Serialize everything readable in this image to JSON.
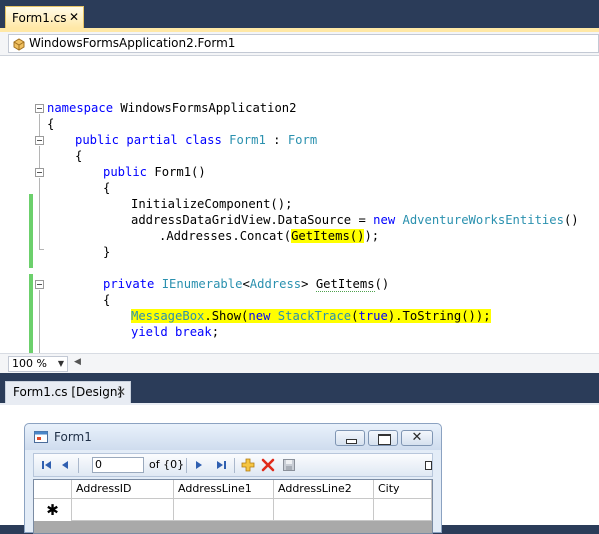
{
  "editor": {
    "tab_label": "Form1.cs",
    "tab_close": "✕",
    "nav_class": "WindowsFormsApplication2.Form1",
    "zoom": "100 %",
    "code": {
      "l1_kw": "namespace",
      "l1_rest": " WindowsFormsApplication2",
      "l2": "{",
      "l3_kw1": "public",
      "l3_kw2": "partial",
      "l3_kw3": "class",
      "l3_name": "Form1",
      "l3_colon": " : ",
      "l3_base": "Form",
      "l4": "{",
      "l5_kw": "public",
      "l5_rest": " Form1()",
      "l6": "{",
      "l7": "InitializeComponent();",
      "l8_a": "addressDataGridView.DataSource = ",
      "l8_kw": "new",
      "l8_type": "AdventureWorksEntities",
      "l8_b": "()",
      "l9_a": ".Addresses.Concat(",
      "l9_hl": "GetItems()",
      "l9_b": ");",
      "l10": "}",
      "l11_kw": "private",
      "l11_type1": "IEnumerable",
      "l11_lt": "<",
      "l11_type2": "Address",
      "l11_gt": ">",
      "l11_name": "GetItems",
      "l11_paren": "()",
      "l12": "{",
      "l13_type1": "MessageBox",
      "l13_a": ".Show(",
      "l13_kw": "new",
      "l13_type2": "StackTrace",
      "l13_b": "(",
      "l13_kw2": "true",
      "l13_c": ").ToString());",
      "l14_kw1": "yield",
      "l14_kw2": "break",
      "l14_rest": ";",
      "l15": "}",
      "l16": "}"
    }
  },
  "designer": {
    "tab_label": "Form1.cs [Design]",
    "tab_close": "✕",
    "form_title": "Form1",
    "close_glyph": "✕",
    "navigator": {
      "position": "0",
      "count": "of {0}"
    },
    "grid": {
      "columns": [
        "AddressID",
        "AddressLine1",
        "AddressLine2",
        "City"
      ],
      "new_row_marker": "✱"
    }
  },
  "colors": {
    "highlight": "#ffff00",
    "keyword": "#0000ff",
    "type": "#2b91af",
    "change_bar": "#6cd06c",
    "tab_active": "#ffe8a6",
    "chrome": "#2b3c59"
  }
}
